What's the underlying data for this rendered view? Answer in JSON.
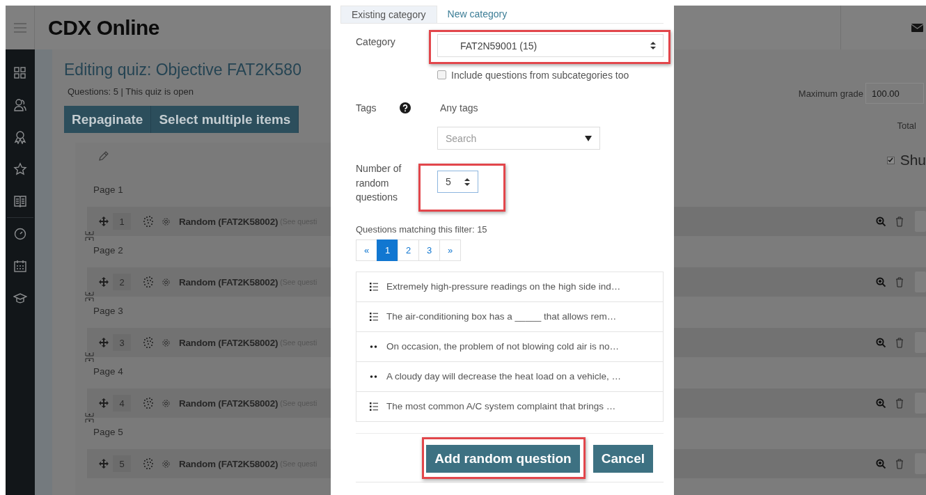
{
  "header": {
    "logo": "CDX Online"
  },
  "quiz": {
    "title": "Editing quiz: Objective FAT2K580",
    "info": "Questions: 5 | This quiz is open",
    "toolbar": [
      "Repaginate",
      "Select multiple items"
    ],
    "pages": [
      {
        "label": "Page 1",
        "question": {
          "number": "1",
          "name": "Random (FAT2K58002)",
          "note": "(See questi"
        }
      },
      {
        "label": "Page 2",
        "question": {
          "number": "2",
          "name": "Random (FAT2K58002)",
          "note": "(See questi"
        }
      },
      {
        "label": "Page 3",
        "question": {
          "number": "3",
          "name": "Random (FAT2K58002)",
          "note": "(See questi"
        }
      },
      {
        "label": "Page 4",
        "question": {
          "number": "4",
          "name": "Random (FAT2K58002)",
          "note": "(See questi"
        }
      },
      {
        "label": "Page 5",
        "question": {
          "number": "5",
          "name": "Random (FAT2K58002)",
          "note": "(See questi"
        }
      }
    ],
    "maximum_grade": {
      "label": "Maximum grade",
      "value": "100.00"
    },
    "total_label": "Total",
    "shuffle": {
      "label": "Shu",
      "checked": true
    }
  },
  "dialog": {
    "tabs": [
      {
        "label": "Existing category",
        "selected": true
      },
      {
        "label": "New category",
        "selected": false
      }
    ],
    "category": {
      "label": "Category",
      "value": "FAT2N59001 (15)",
      "highlighted": true
    },
    "include_subcategories": {
      "label": "Include questions from subcategories too",
      "checked": false
    },
    "tags": {
      "label": "Tags",
      "value": "Any tags",
      "search_placeholder": "Search"
    },
    "count": {
      "label": "Number of random questions",
      "value": "5",
      "focused": true,
      "highlighted": true
    },
    "matching": "Questions matching this filter: 15",
    "pagination": [
      {
        "label": "«",
        "selected": false
      },
      {
        "label": "1",
        "selected": true
      },
      {
        "label": "2",
        "selected": false
      },
      {
        "label": "3",
        "selected": false
      },
      {
        "label": "»",
        "selected": false
      }
    ],
    "questions": [
      {
        "kind": "multichoice",
        "text": "Extremely high-pressure readings on the high side ind…"
      },
      {
        "kind": "multichoice",
        "text": "The air-conditioning box has a _____ that allows rem…"
      },
      {
        "kind": "truefalse",
        "text": "On occasion, the problem of not blowing cold air is no…"
      },
      {
        "kind": "truefalse",
        "text": "A cloudy day will decrease the heat load on a vehicle, …"
      },
      {
        "kind": "multichoice",
        "text": "The most common A/C system complaint that brings …"
      }
    ],
    "buttons": [
      {
        "label": "Add random question",
        "highlighted": true
      },
      {
        "label": "Cancel",
        "highlighted": false
      }
    ]
  }
}
